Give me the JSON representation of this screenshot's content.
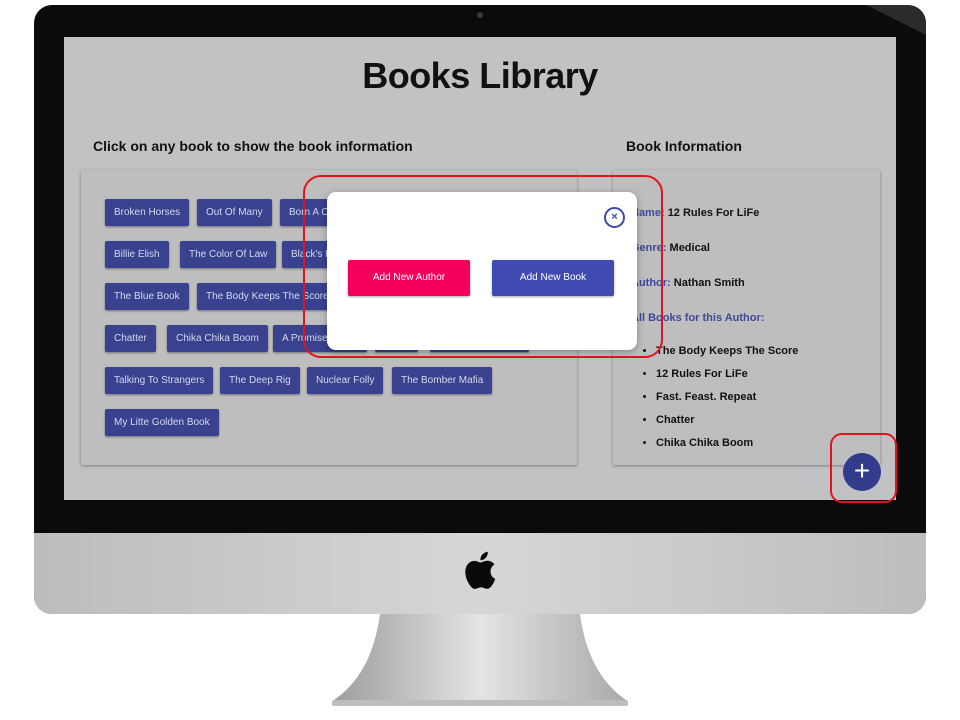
{
  "app": {
    "title": "Books Library"
  },
  "left_panel": {
    "heading": "Click on any book to show the book information",
    "books": [
      "Broken Horses",
      "Out Of Many",
      "Born A Crime",
      "Billie Elish",
      "The Color Of Law",
      "Black's Law",
      "The Blue Book",
      "The Body Keeps The Score",
      "Chatter",
      "Chika Chika Boom",
      "A Promised Land",
      "Talking To Strangers",
      "The Deep Rig",
      "Nuclear Folly",
      "The Bomber Mafia",
      "My Litte Golden Book"
    ]
  },
  "right_panel": {
    "heading": "Book Information",
    "name_label": "Name:",
    "name_value": "12 Rules For LiFe",
    "genre_label": "Genre:",
    "genre_value": "Medical",
    "author_label": "Author:",
    "author_value": "Nathan Smith",
    "all_books_label": "All Books for this Author:",
    "author_books": [
      "The Body Keeps The Score",
      "12 Rules For LiFe",
      "Fast. Feast. Repeat",
      "Chatter",
      "Chika Chika Boom"
    ]
  },
  "modal": {
    "close_symbol": "×",
    "add_author_label": "Add New Author",
    "add_book_label": "Add New Book"
  },
  "fab": {
    "symbol": "+"
  },
  "colors": {
    "primary": "#38428f",
    "accent": "#f2005a",
    "highlight": "#e2141b"
  },
  "icons": [
    "close-icon",
    "plus-icon",
    "apple-logo-icon"
  ]
}
